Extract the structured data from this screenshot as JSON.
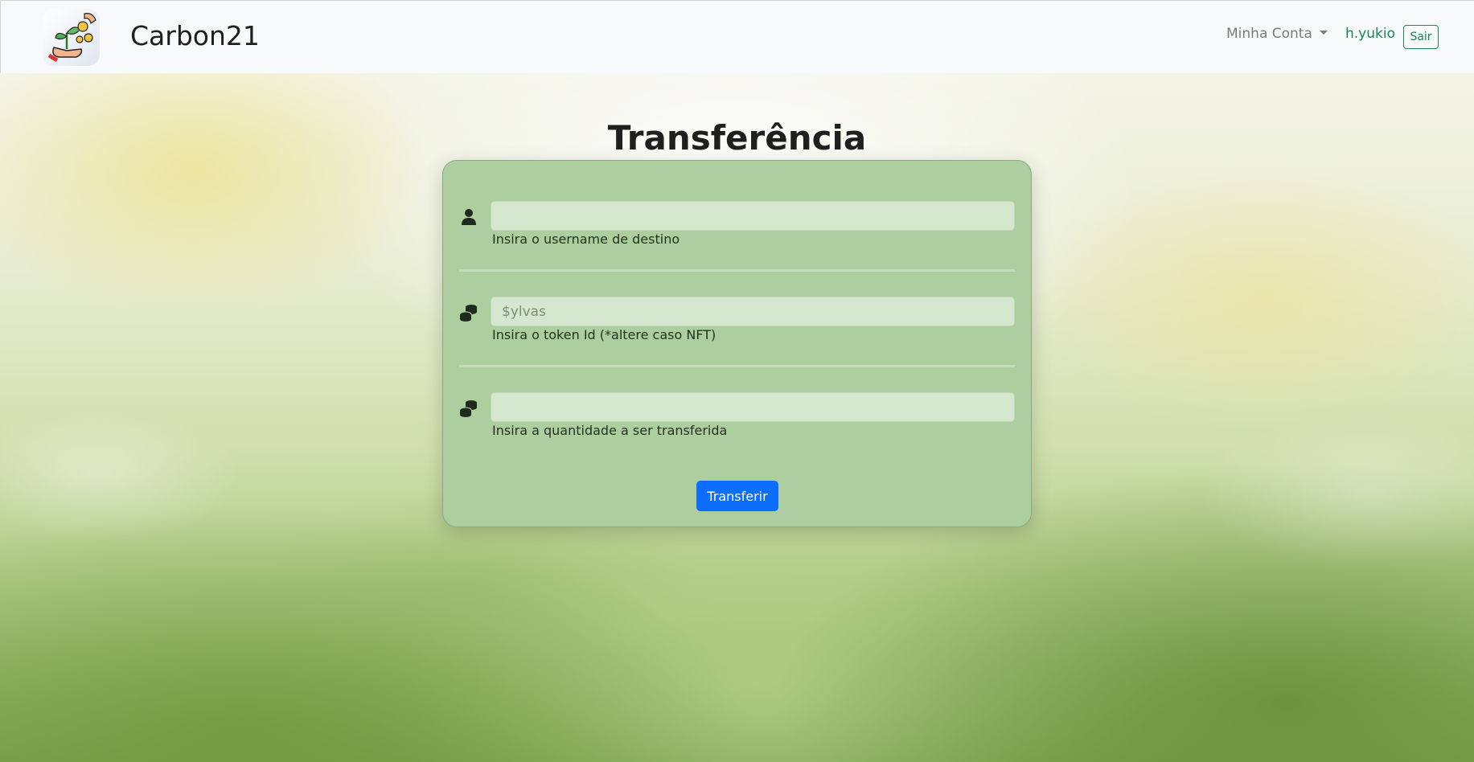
{
  "navbar": {
    "brand": "Carbon21",
    "account_menu": "Minha Conta",
    "username": "h.yukio",
    "logout_label": "Sair"
  },
  "page": {
    "title": "Transferência"
  },
  "form": {
    "username_field": {
      "value": "",
      "placeholder": "",
      "help": "Insira o username de destino",
      "icon": "user-icon"
    },
    "token_field": {
      "value": "",
      "placeholder": "$ylvas",
      "help": "Insira o token Id (*altere caso NFT)",
      "icon": "coins-icon"
    },
    "amount_field": {
      "value": "",
      "placeholder": "",
      "help": "Insira a quantidade a ser transferida",
      "icon": "coins-icon"
    },
    "submit_label": "Transferir"
  },
  "colors": {
    "primary": "#0d6efd",
    "success": "#198754",
    "card_bg": "#adce9e",
    "field_bg": "#d6e7cf"
  }
}
